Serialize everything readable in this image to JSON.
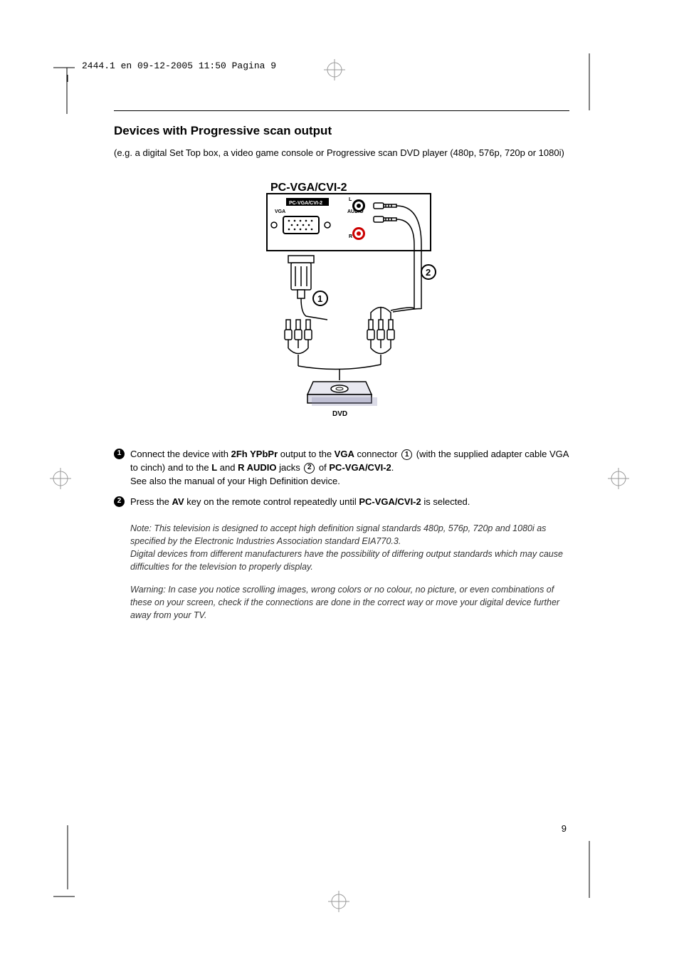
{
  "header": "2444.1 en  09-12-2005  11:50  Pagina 9",
  "title": "Devices with Progressive scan output",
  "intro": "(e.g. a digital Set Top box, a video game console or Progressive scan DVD player (480p, 576p, 720p or 1080i)",
  "diagram": {
    "panel_title": "PC-VGA/CVI-2",
    "panel_label_small": "PC-VGA/CVI-2",
    "vga_label": "VGA",
    "audio_label": "AUDIO",
    "audio_l": "L",
    "audio_r": "R",
    "callout_1": "1",
    "callout_2": "2",
    "device_label": "DVD"
  },
  "steps": [
    {
      "num": "1",
      "pre1": "Connect the device with ",
      "bold1": "2Fh YPbPr",
      "mid1": " output to the ",
      "bold2": "VGA",
      "mid2": " connector ",
      "circle1": "1",
      "mid3": " (with the supplied adapter cable VGA to cinch) and to the ",
      "bold3": "L",
      "mid4": " and ",
      "bold4": "R AUDIO",
      "mid5": " jacks ",
      "circle2": "2",
      "mid6": " of ",
      "bold5": "PC-VGA/CVI-2",
      "end": ".",
      "line2": "See also the manual of your High Definition device."
    },
    {
      "num": "2",
      "pre1": "Press the ",
      "bold1": "AV",
      "mid1": " key on the remote control repeatedly until ",
      "bold2": "PC-VGA/CVI-2",
      "end": " is selected."
    }
  ],
  "note": "Note: This television is designed to accept high definition signal standards 480p, 576p, 720p and 1080i as specified by the Electronic Industries Association standard EIA770.3.",
  "note2": "Digital devices from different manufacturers have the possibility of differing output standards which may cause difficulties for the television to properly display.",
  "warning": "Warning: In case you notice scrolling images, wrong colors or no colour, no picture, or even combinations of these on your screen, check if the connections are done in the correct way or move your digital device further away from your TV.",
  "page_number": "9"
}
